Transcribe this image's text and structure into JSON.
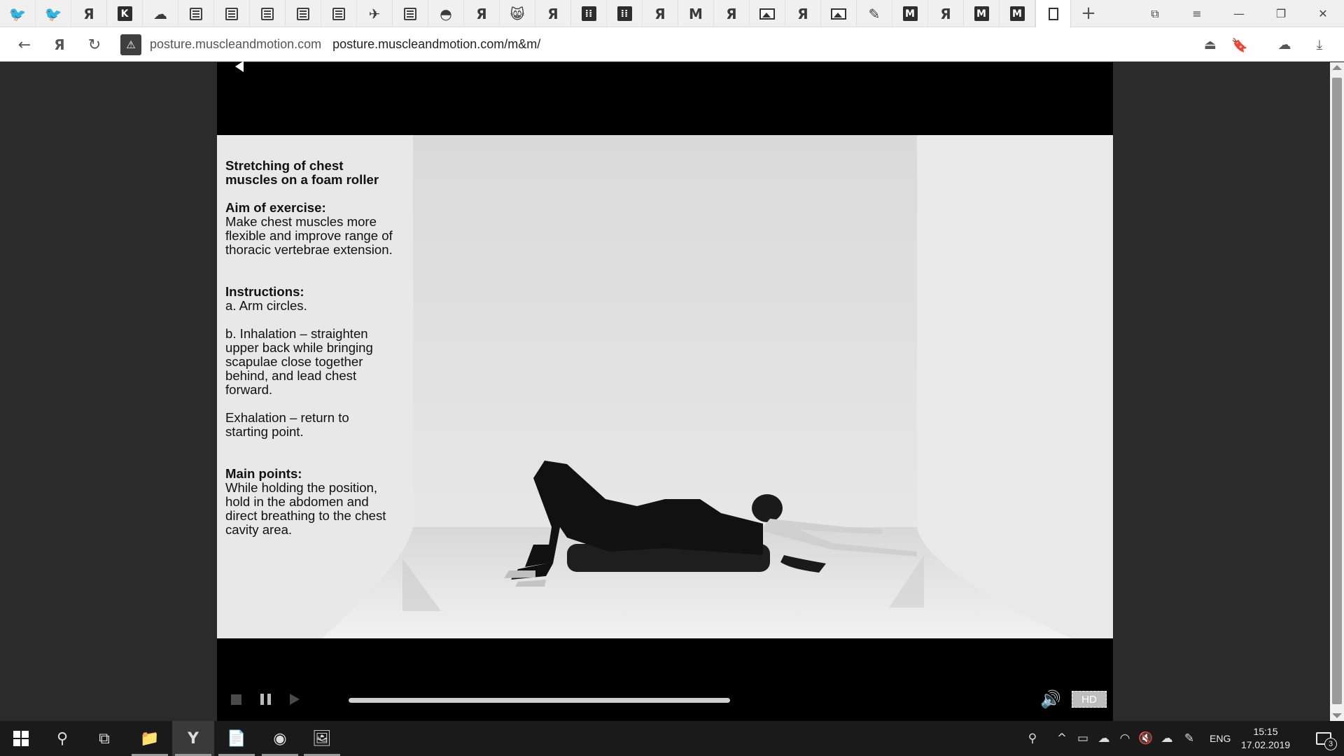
{
  "browser": {
    "tabs": [
      {
        "icon": "bird-icon",
        "glyph": "🐦"
      },
      {
        "icon": "bird-icon",
        "glyph": "🐦"
      },
      {
        "icon": "yandex-icon",
        "glyph": "Я"
      },
      {
        "icon": "k-logo-icon",
        "glyph": "K"
      },
      {
        "icon": "cloud-icon",
        "glyph": "☁"
      },
      {
        "icon": "document-icon",
        "glyph": ""
      },
      {
        "icon": "document-icon",
        "glyph": ""
      },
      {
        "icon": "document-icon",
        "glyph": ""
      },
      {
        "icon": "document-icon",
        "glyph": ""
      },
      {
        "icon": "document-icon",
        "glyph": ""
      },
      {
        "icon": "fish-icon",
        "glyph": "✈"
      },
      {
        "icon": "document-icon",
        "glyph": ""
      },
      {
        "icon": "swirl-icon",
        "glyph": "◓"
      },
      {
        "icon": "yandex-icon",
        "glyph": "Я"
      },
      {
        "icon": "cat-icon",
        "glyph": "😸"
      },
      {
        "icon": "yandex-icon",
        "glyph": "Я"
      },
      {
        "icon": "dots-box-icon",
        "glyph": "⁞⁞"
      },
      {
        "icon": "dots-box-icon",
        "glyph": "⁞⁞"
      },
      {
        "icon": "yandex-icon",
        "glyph": "Я"
      },
      {
        "icon": "m-logo-icon",
        "glyph": "M"
      },
      {
        "icon": "yandex-icon",
        "glyph": "Я"
      },
      {
        "icon": "image-icon",
        "glyph": ""
      },
      {
        "icon": "yandex-icon",
        "glyph": "Я"
      },
      {
        "icon": "image-icon",
        "glyph": ""
      },
      {
        "icon": "feather-icon",
        "glyph": "✎"
      },
      {
        "icon": "m-box-icon",
        "glyph": "M"
      },
      {
        "icon": "yandex-icon",
        "glyph": "Я"
      },
      {
        "icon": "m-box-icon",
        "glyph": "M"
      },
      {
        "icon": "m-box-icon",
        "glyph": "M"
      },
      {
        "icon": "blank-page-icon",
        "glyph": "",
        "active": true
      }
    ],
    "new_tab_glyph": "+",
    "window_controls": {
      "bookmarks_glyph": "⧉",
      "menu_glyph": "≡",
      "minimize_glyph": "—",
      "restore_glyph": "❐",
      "close_glyph": "✕"
    }
  },
  "address_bar": {
    "back_glyph": "←",
    "yandex_glyph": "Я",
    "reload_glyph": "↻",
    "lock_glyph": "⚠",
    "domain": "posture.muscleandmotion.com",
    "path": "posture.muscleandmotion.com/m&m/",
    "right_icons": [
      "turbo-icon",
      "bookmark-icon",
      "extension-icon",
      "download-icon"
    ],
    "right_glyphs": [
      "⏏",
      "🔖",
      "☁",
      "⤓"
    ]
  },
  "slide": {
    "title": "Stretching of chest muscles on a foam roller",
    "aim_heading": "Aim of exercise:",
    "aim_text": "Make chest muscles more flexible and improve range of thoracic vertebrae extension.",
    "instructions_heading": "Instructions:",
    "instruction_a": "a. Arm circles.",
    "instruction_b": "b. Inhalation – straighten upper back while bringing scapulae close together behind, and lead chest forward.",
    "instruction_c": "Exhalation – return to starting point.",
    "main_points_heading": "Main points:",
    "main_points_text": "While holding the position, hold in the abdomen and direct breathing to the chest cavity area."
  },
  "player": {
    "progress_fraction": 1.0,
    "volume_glyph": "🔊",
    "hd_label": "HD"
  },
  "taskbar": {
    "apps": [
      "file-explorer-icon",
      "yandex-browser-icon",
      "notepad-icon",
      "firefox-icon",
      "media-player-icon"
    ],
    "language": "ENG",
    "time": "15:15",
    "date": "17.02.2019",
    "notifications_count": "3",
    "tray_glyphs": [
      "⚲",
      "^",
      "▭",
      "☁",
      "◠",
      "🔇",
      "☁",
      "✎"
    ]
  }
}
